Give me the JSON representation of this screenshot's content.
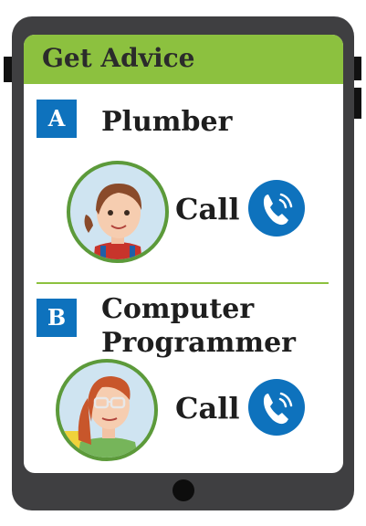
{
  "header": {
    "title": "Get Advice"
  },
  "contacts": [
    {
      "letter": "A",
      "name_line1": "Plumber",
      "name_line2": "",
      "call_label": "Call",
      "avatar_icon": "woman-ponytail-avatar"
    },
    {
      "letter": "B",
      "name_line1": "Computer",
      "name_line2": "Programmer",
      "call_label": "Call",
      "avatar_icon": "woman-glasses-avatar"
    }
  ],
  "colors": {
    "accent_green": "#8cc13f",
    "accent_blue": "#0e72bd",
    "device": "#3f3f41"
  },
  "icons": {
    "call": "phone-call-icon"
  }
}
